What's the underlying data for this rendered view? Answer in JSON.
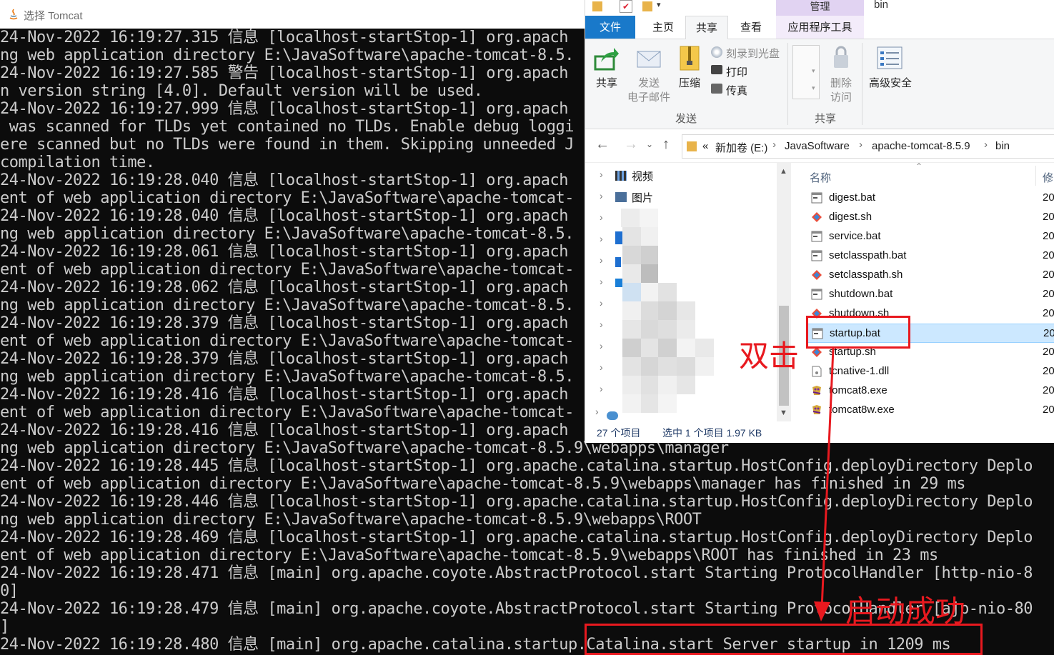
{
  "console": {
    "title": "选择 Tomcat",
    "lines": [
      "24-Nov-2022 16:19:27.315 信息 [localhost-startStop-1] org.apach",
      "ng web application directory E:\\JavaSoftware\\apache-tomcat-8.5.",
      "24-Nov-2022 16:19:27.585 警告 [localhost-startStop-1] org.apach",
      "n version string [4.0]. Default version will be used.",
      "24-Nov-2022 16:19:27.999 信息 [localhost-startStop-1] org.apach",
      " was scanned for TLDs yet contained no TLDs. Enable debug loggi",
      "ere scanned but no TLDs were found in them. Skipping unneeded J",
      "compilation time.",
      "24-Nov-2022 16:19:28.040 信息 [localhost-startStop-1] org.apach",
      "ent of web application directory E:\\JavaSoftware\\apache-tomcat-",
      "24-Nov-2022 16:19:28.040 信息 [localhost-startStop-1] org.apach",
      "ng web application directory E:\\JavaSoftware\\apache-tomcat-8.5.",
      "24-Nov-2022 16:19:28.061 信息 [localhost-startStop-1] org.apach",
      "ent of web application directory E:\\JavaSoftware\\apache-tomcat-",
      "24-Nov-2022 16:19:28.062 信息 [localhost-startStop-1] org.apach",
      "ng web application directory E:\\JavaSoftware\\apache-tomcat-8.5.",
      "24-Nov-2022 16:19:28.379 信息 [localhost-startStop-1] org.apach",
      "ent of web application directory E:\\JavaSoftware\\apache-tomcat-",
      "24-Nov-2022 16:19:28.379 信息 [localhost-startStop-1] org.apach",
      "ng web application directory E:\\JavaSoftware\\apache-tomcat-8.5.",
      "24-Nov-2022 16:19:28.416 信息 [localhost-startStop-1] org.apach",
      "ent of web application directory E:\\JavaSoftware\\apache-tomcat-",
      "24-Nov-2022 16:19:28.416 信息 [localhost-startStop-1] org.apach",
      "ng web application directory E:\\JavaSoftware\\apache-tomcat-8.5.9\\webapps\\manager",
      "24-Nov-2022 16:19:28.445 信息 [localhost-startStop-1] org.apache.catalina.startup.HostConfig.deployDirectory Deplo",
      "ent of web application directory E:\\JavaSoftware\\apache-tomcat-8.5.9\\webapps\\manager has finished in 29 ms",
      "24-Nov-2022 16:19:28.446 信息 [localhost-startStop-1] org.apache.catalina.startup.HostConfig.deployDirectory Deplo",
      "ng web application directory E:\\JavaSoftware\\apache-tomcat-8.5.9\\webapps\\ROOT",
      "24-Nov-2022 16:19:28.469 信息 [localhost-startStop-1] org.apache.catalina.startup.HostConfig.deployDirectory Deplo",
      "ent of web application directory E:\\JavaSoftware\\apache-tomcat-8.5.9\\webapps\\ROOT has finished in 23 ms",
      "24-Nov-2022 16:19:28.471 信息 [main] org.apache.coyote.AbstractProtocol.start Starting ProtocolHandler [http-nio-8",
      "0]",
      "24-Nov-2022 16:19:28.479 信息 [main] org.apache.coyote.AbstractProtocol.start Starting ProtocolHandler [ajp-nio-80",
      "]",
      "24-Nov-2022 16:19:28.480 信息 [main] org.apache.catalina.startup.Catalina.start Server startup in 1209 ms"
    ]
  },
  "explorer": {
    "path_title": "bin",
    "manage_tab": "管理",
    "tabs": [
      "文件",
      "主页",
      "共享",
      "查看",
      "应用程序工具"
    ],
    "ribbon": {
      "share": "共享",
      "email": "发送\n电子邮件",
      "zip": "压缩",
      "burn": "刻录到光盘",
      "print": "打印",
      "fax": "传真",
      "group_send": "发送",
      "remove_access": "删除\n访问",
      "group_share": "共享",
      "advanced_security": "高级安全"
    },
    "breadcrumb": [
      "«",
      "新加卷 (E:)",
      "JavaSoftware",
      "apache-tomcat-8.5.9",
      "bin"
    ],
    "nav_items": [
      "视频",
      "图片"
    ],
    "columns": {
      "name": "名称",
      "date": "修"
    },
    "files": [
      {
        "name": "digest.bat",
        "date": "20",
        "icon": "bat-icon"
      },
      {
        "name": "digest.sh",
        "date": "20",
        "icon": "sh-icon"
      },
      {
        "name": "service.bat",
        "date": "20",
        "icon": "bat-icon"
      },
      {
        "name": "setclasspath.bat",
        "date": "20",
        "icon": "bat-icon"
      },
      {
        "name": "setclasspath.sh",
        "date": "20",
        "icon": "sh-icon"
      },
      {
        "name": "shutdown.bat",
        "date": "20",
        "icon": "bat-icon"
      },
      {
        "name": "shutdown.sh",
        "date": "20",
        "icon": "sh-icon"
      },
      {
        "name": "startup.bat",
        "date": "20",
        "icon": "bat-icon"
      },
      {
        "name": "startup.sh",
        "date": "20",
        "icon": "sh-icon"
      },
      {
        "name": "tcnative-1.dll",
        "date": "20",
        "icon": "dll-icon"
      },
      {
        "name": "tomcat8.exe",
        "date": "20",
        "icon": "exe-icon"
      },
      {
        "name": "tomcat8w.exe",
        "date": "20",
        "icon": "exe-icon"
      }
    ],
    "selected_file": "startup.bat",
    "status": {
      "count": "27 个项目",
      "selection": "选中 1 个项目  1.97 KB"
    }
  },
  "annotations": {
    "double_click": "双击",
    "started": "启动成功",
    "color": "#e8191f"
  }
}
